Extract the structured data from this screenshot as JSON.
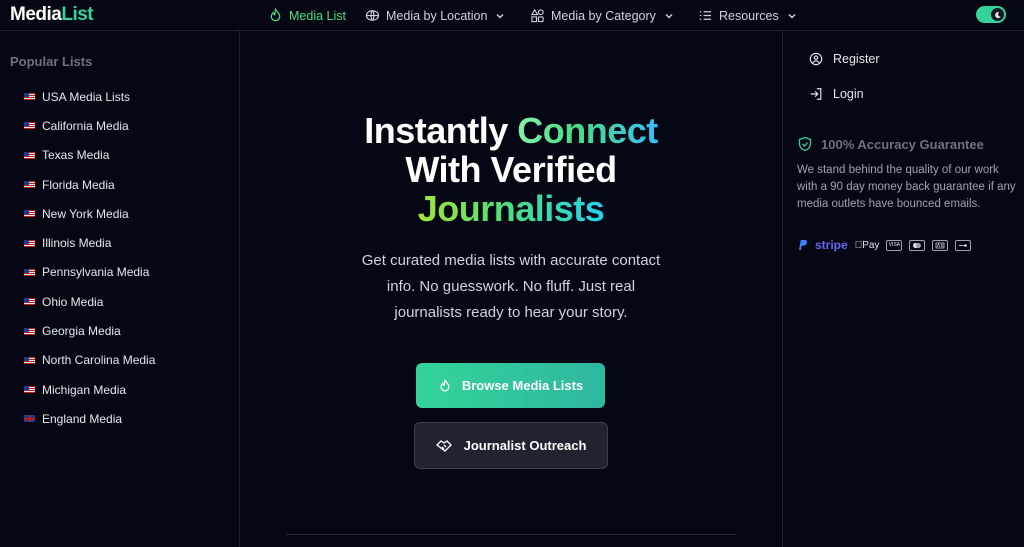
{
  "header": {
    "logo_main": "Media",
    "logo_accent": "List",
    "nav": [
      {
        "label": "Media List",
        "icon": "fire-icon",
        "active": true
      },
      {
        "label": "Media by Location",
        "icon": "globe-icon",
        "dropdown": true
      },
      {
        "label": "Media by Category",
        "icon": "category-icon",
        "dropdown": true
      },
      {
        "label": "Resources",
        "icon": "list-icon",
        "dropdown": true
      }
    ],
    "theme_toggle": {
      "state": "dark",
      "icon": "moon-icon",
      "color": "#34d399"
    }
  },
  "sidebar": {
    "title": "Popular Lists",
    "items": [
      {
        "label": "USA Media Lists",
        "flag": "us"
      },
      {
        "label": "California Media",
        "flag": "us"
      },
      {
        "label": "Texas Media",
        "flag": "us"
      },
      {
        "label": "Florida Media",
        "flag": "us"
      },
      {
        "label": "New York Media",
        "flag": "us"
      },
      {
        "label": "Illinois Media",
        "flag": "us"
      },
      {
        "label": "Pennsylvania Media",
        "flag": "us"
      },
      {
        "label": "Ohio Media",
        "flag": "us"
      },
      {
        "label": "Georgia Media",
        "flag": "us"
      },
      {
        "label": "North Carolina Media",
        "flag": "us"
      },
      {
        "label": "Michigan Media",
        "flag": "us"
      },
      {
        "label": "England Media",
        "flag": "uk"
      }
    ]
  },
  "hero": {
    "line1_plain": "Instantly ",
    "line1_accent": "Connect",
    "line2": "With Verified",
    "line3_accent": "Journalists",
    "subtext": "Get curated media lists with accurate contact info. No guesswork. No fluff. Just real journalists ready to hear your story.",
    "primary_button": "Browse Media Lists",
    "secondary_button": "Journalist Outreach"
  },
  "right_panel": {
    "register": "Register",
    "login": "Login",
    "guarantee_title": "100% Accuracy Guarantee",
    "guarantee_text": "We stand behind the quality of our work with a 90 day money back guarantee if any media outlets have bounced emails.",
    "payments": {
      "stripe": "stripe",
      "apple_pay": "Pay",
      "visa": "VISA",
      "icons": [
        "paypal-icon",
        "stripe-logo",
        "apple-pay-icon",
        "visa-icon",
        "mastercard-icon",
        "amex-icon",
        "discover-icon"
      ]
    }
  },
  "colors": {
    "background": "#050814",
    "accent": "#34d399",
    "primary_button": "#34d399",
    "secondary_button": "#1f2430"
  }
}
